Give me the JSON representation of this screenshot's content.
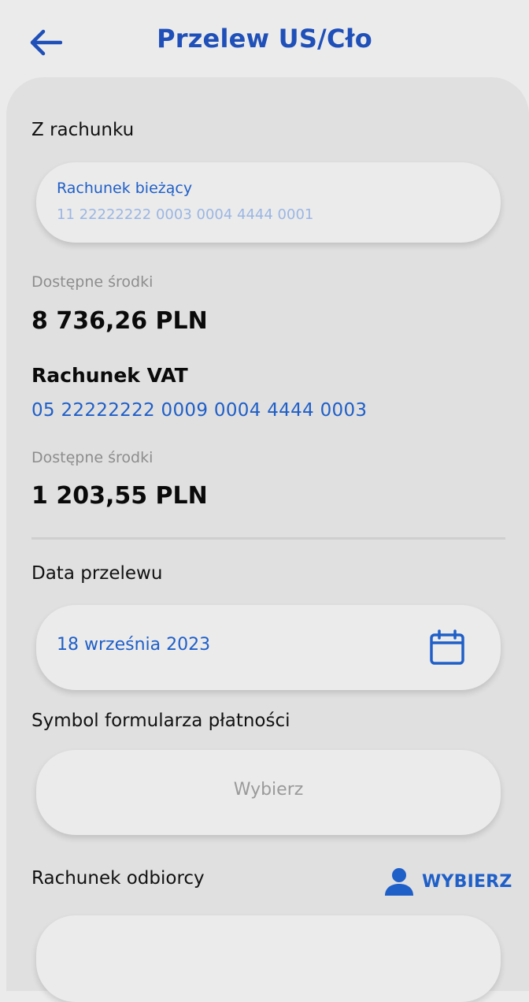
{
  "header": {
    "title": "Przelew US/Cło",
    "back_icon": "arrow-left-icon"
  },
  "colors": {
    "accent": "#1f4fb8",
    "link": "#1f5fc8",
    "background": "#ebebeb",
    "card": "#e0e0e0"
  },
  "from_account": {
    "label": "Z rachunku",
    "account_name": "Rachunek bieżący",
    "account_number": "11 22222222 0003 0004 4444 0001",
    "available_label": "Dostępne środki",
    "available_amount": "8 736,26 PLN"
  },
  "vat_account": {
    "title": "Rachunek VAT",
    "number": "05 22222222 0009 0004 4444 0003",
    "available_label": "Dostępne środki",
    "available_amount": "1 203,55 PLN"
  },
  "transfer_date": {
    "label": "Data przelewu",
    "value": "18 września 2023",
    "icon": "calendar-icon"
  },
  "form_symbol": {
    "label": "Symbol formularza płatności",
    "placeholder": "Wybierz"
  },
  "recipient_account": {
    "label": "Rachunek odbiorcy",
    "choose_label": "WYBIERZ",
    "choose_icon": "person-icon"
  }
}
